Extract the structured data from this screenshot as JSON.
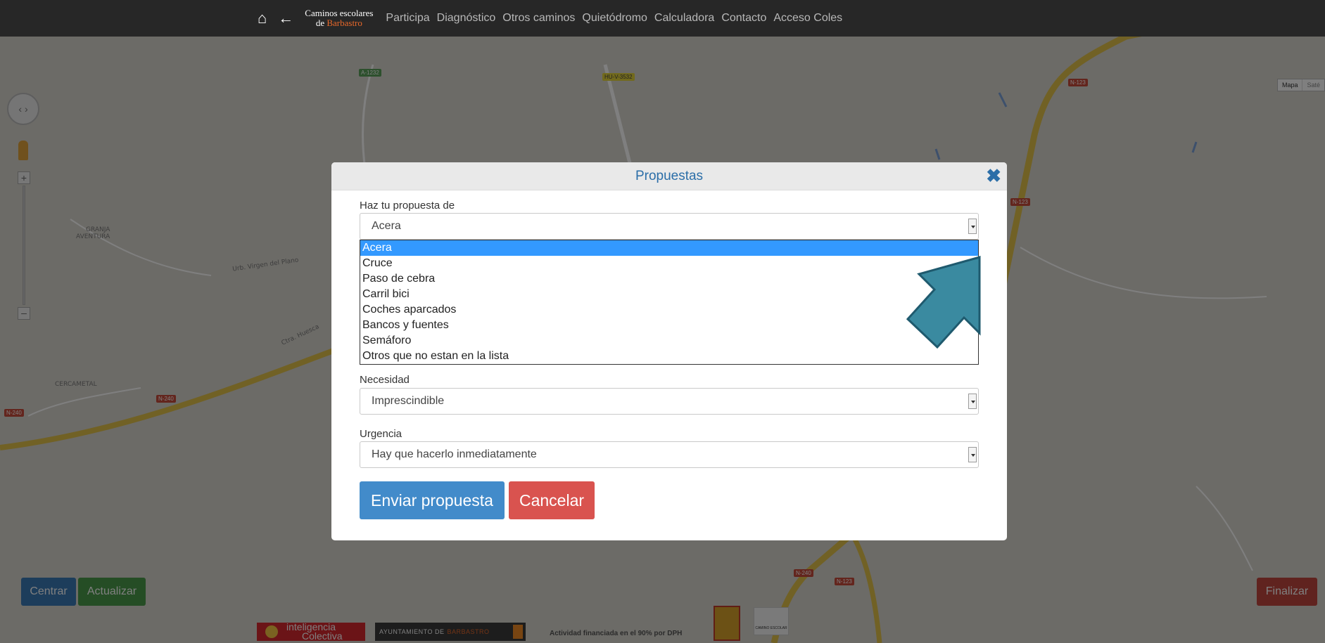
{
  "navbar": {
    "home_icon": "home-icon",
    "back_icon": "back-arrow-icon",
    "brand_line1": "Caminos escolares",
    "brand_line2_prefix": "de ",
    "brand_line2_highlight": "Barbastro",
    "links": [
      "Participa",
      "Diagnóstico",
      "Otros caminos",
      "Quietódromo",
      "Calculadora",
      "Contacto",
      "Acceso Coles"
    ]
  },
  "map": {
    "labels": {
      "granja_1": "GRANJA",
      "granja_2": "AVENTURA",
      "cercametal": "CERCAMETAL",
      "ctra_huesca": "Ctra. Huesca",
      "virgen_plano": "Urb. Virgen del Plano"
    },
    "shields": {
      "a1232": "A-1232",
      "hu": "HU-V-3532",
      "n123_a": "N-123",
      "n123_b": "N-123",
      "n240_a": "N-240",
      "n240_b": "N-240",
      "n240_c": "N-240",
      "n123_c": "N-123"
    },
    "map_type": [
      "Mapa",
      "Saté"
    ]
  },
  "buttons": {
    "centrar": "Centrar",
    "actualizar": "Actualizar",
    "finalizar": "Finalizar"
  },
  "footer": {
    "ic_line1": "inteligencia",
    "ic_line2": "Colectiva",
    "ayto_prefix": "AYUNTAMIENTO DE",
    "ayto_highlight": "BARBASTRO",
    "financing": "Actividad financiada en el 90% por DPH",
    "camino_escolar": "CAMINO ESCOLAR"
  },
  "modal": {
    "title": "Propuestas",
    "close_icon": "close-icon",
    "propuesta_label": "Haz tu propuesta de",
    "propuesta_value": "Acera",
    "propuesta_options": [
      "Acera",
      "Cruce",
      "Paso de cebra",
      "Carril bici",
      "Coches aparcados",
      "Bancos y fuentes",
      "Semáforo",
      "Otros que no estan en la lista"
    ],
    "propuesta_selected_index": 0,
    "necesidad_label": "Necesidad",
    "necesidad_value": "Imprescindible",
    "urgencia_label": "Urgencia",
    "urgencia_value": "Hay que hacerlo inmediatamente",
    "enviar_label": "Enviar propuesta",
    "cancelar_label": "Cancelar"
  },
  "colors": {
    "navbar": "#272727",
    "primary": "#428bca",
    "danger": "#d9534f",
    "success": "#4a9a4a",
    "selected_option": "#3399ff",
    "annotation_arrow": "#3a8aa0"
  }
}
